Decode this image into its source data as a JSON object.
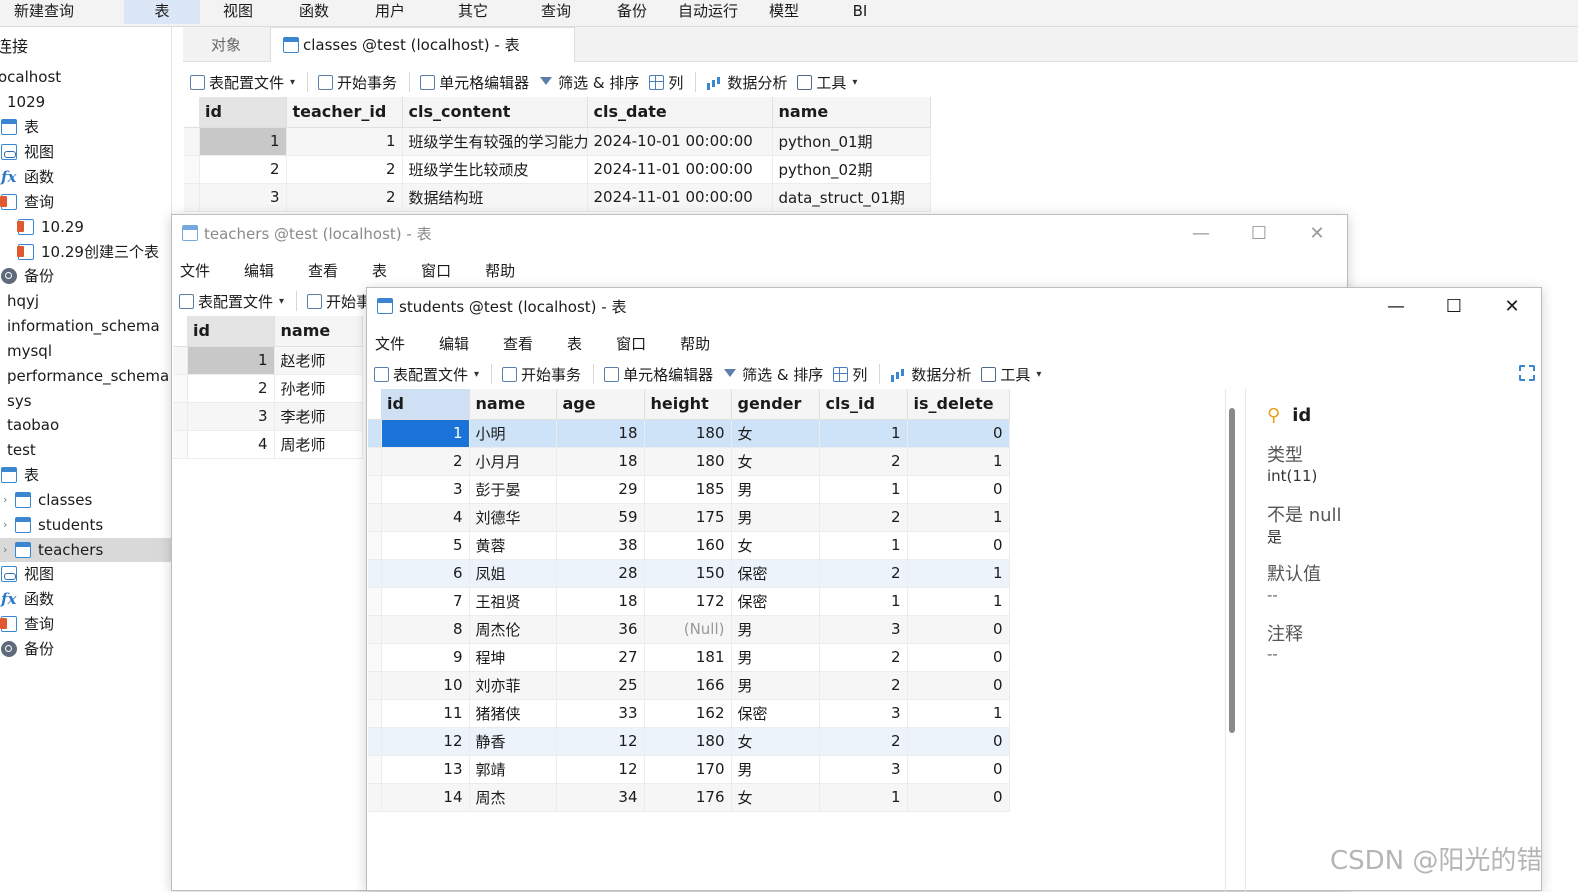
{
  "menu": [
    "新建查询",
    "表",
    "视图",
    "函数",
    "用户",
    "其它",
    "查询",
    "备份",
    "自动运行",
    "模型",
    "BI"
  ],
  "sidebar": {
    "items": [
      "连接",
      "ocalhost",
      "1029",
      "表",
      "视图",
      "函数",
      "查询",
      "10.29",
      "10.29创建三个表",
      "备份",
      "hqyj",
      "information_schema",
      "mysql",
      "performance_schema",
      "sys",
      "taobao",
      "test",
      "表",
      "classes",
      "students",
      "teachers",
      "视图",
      "函数",
      "查询",
      "备份"
    ]
  },
  "tabs": {
    "objects": "对象",
    "classes": "classes @test (localhost) - 表"
  },
  "toolbar": {
    "profile": "表配置文件",
    "transaction": "开始事务",
    "cell_editor": "单元格编辑器",
    "filter_sort": "筛选 & 排序",
    "columns": "列",
    "analysis": "数据分析",
    "tools": "工具"
  },
  "classes": {
    "headers": [
      "id",
      "teacher_id",
      "cls_content",
      "cls_date",
      "name"
    ],
    "rows": [
      [
        "1",
        "1",
        "班级学生有较强的学习能力",
        "2024-10-01 00:00:00",
        "python_01期"
      ],
      [
        "2",
        "2",
        "班级学生比较顽皮",
        "2024-11-01 00:00:00",
        "python_02期"
      ],
      [
        "3",
        "2",
        "数据结构班",
        "2024-11-01 00:00:00",
        "data_struct_01期"
      ]
    ]
  },
  "teachers_window": {
    "title": "teachers @test (localhost) - 表",
    "menu": [
      "文件",
      "编辑",
      "查看",
      "表",
      "窗口",
      "帮助"
    ],
    "toolbar_partial": "开始事",
    "headers": [
      "id",
      "name"
    ],
    "rows": [
      [
        "1",
        "赵老师"
      ],
      [
        "2",
        "孙老师"
      ],
      [
        "3",
        "李老师"
      ],
      [
        "4",
        "周老师"
      ]
    ]
  },
  "students_window": {
    "title": "students @test (localhost) - 表",
    "menu": [
      "文件",
      "编辑",
      "查看",
      "表",
      "窗口",
      "帮助"
    ],
    "headers": [
      "id",
      "name",
      "age",
      "height",
      "gender",
      "cls_id",
      "is_delete"
    ],
    "rows": [
      [
        "1",
        "小明",
        "18",
        "180",
        "女",
        "1",
        "0"
      ],
      [
        "2",
        "小月月",
        "18",
        "180",
        "女",
        "2",
        "1"
      ],
      [
        "3",
        "彭于晏",
        "29",
        "185",
        "男",
        "1",
        "0"
      ],
      [
        "4",
        "刘德华",
        "59",
        "175",
        "男",
        "2",
        "1"
      ],
      [
        "5",
        "黄蓉",
        "38",
        "160",
        "女",
        "1",
        "0"
      ],
      [
        "6",
        "凤姐",
        "28",
        "150",
        "保密",
        "2",
        "1"
      ],
      [
        "7",
        "王祖贤",
        "18",
        "172",
        "保密",
        "1",
        "1"
      ],
      [
        "8",
        "周杰伦",
        "36",
        "(Null)",
        "男",
        "3",
        "0"
      ],
      [
        "9",
        "程坤",
        "27",
        "181",
        "男",
        "2",
        "0"
      ],
      [
        "10",
        "刘亦菲",
        "25",
        "166",
        "男",
        "2",
        "0"
      ],
      [
        "11",
        "猪猪侠",
        "33",
        "162",
        "保密",
        "3",
        "1"
      ],
      [
        "12",
        "静香",
        "12",
        "180",
        "女",
        "2",
        "0"
      ],
      [
        "13",
        "郭靖",
        "12",
        "170",
        "男",
        "3",
        "0"
      ],
      [
        "14",
        "周杰",
        "34",
        "176",
        "女",
        "1",
        "0"
      ]
    ],
    "inspector": {
      "field": "id",
      "type_label": "类型",
      "type_value": "int(11)",
      "notnull_label": "不是 null",
      "notnull_value": "是",
      "default_label": "默认值",
      "default_value": "--",
      "comment_label": "注释",
      "comment_value": "--"
    }
  },
  "watermark": "CSDN @阳光的错",
  "colors": {
    "selected_cell": "#1a73d9",
    "header_selected": "#cfe0f5",
    "row_selected": "#cfe3f8",
    "key_icon": "#e5a21b"
  }
}
